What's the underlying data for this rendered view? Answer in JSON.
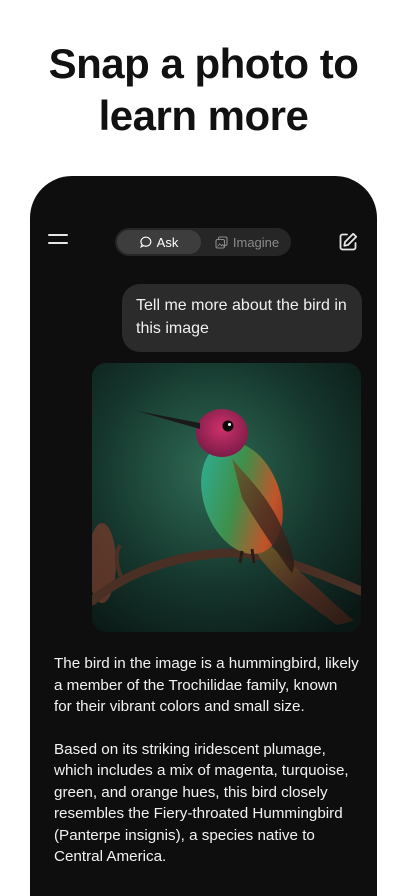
{
  "headline": {
    "line1": "Snap a photo to",
    "line2": "learn more"
  },
  "header": {
    "menu_icon": "hamburger-menu-icon",
    "edit_icon": "new-chat-edit-icon",
    "tabs": [
      {
        "label": "Ask",
        "icon": "chat-bubble-icon",
        "active": true
      },
      {
        "label": "Imagine",
        "icon": "imagine-icon",
        "active": false
      }
    ]
  },
  "chat": {
    "user_message": "Tell me more about the bird in this image",
    "assistant_paragraphs": [
      "The bird in the image is a hummingbird, likely a member of the Trochilidae family, known for their vibrant colors and small size.",
      "Based on its striking iridescent plumage, which includes a mix of magenta, turquoise, green, and orange hues, this bird closely resembles the Fiery-throated Hummingbird (Panterpe insignis), a species native to Central America."
    ]
  },
  "colors": {
    "background": "#ffffff",
    "phone": "#0e0e0e",
    "bubble": "#2b2b2b",
    "accent_text": "#f0f0f0"
  }
}
